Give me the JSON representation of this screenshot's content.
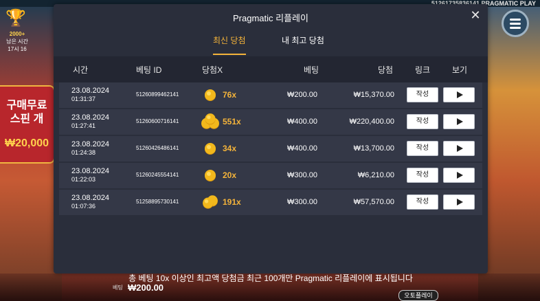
{
  "game": {
    "top_right": "51261735836141 PRAGMATIC PLAY",
    "jackpot_amount": "2000+",
    "time_left_label": "남은 시간",
    "time_left_value": "17시 16",
    "buy_line1": "구매무료",
    "buy_line2": "스핀 개",
    "buy_price": "₩20,000",
    "bet_label": "베팅",
    "bet_value": "₩200.00",
    "autoplay_label": "오토플레이"
  },
  "modal": {
    "title": "Pragmatic 리플레이",
    "close_icon": "close-icon",
    "tabs": [
      {
        "label": "최신 당첨",
        "active": true
      },
      {
        "label": "내 최고 당첨",
        "active": false
      }
    ],
    "columns": {
      "time": "시간",
      "bet_id": "베팅 ID",
      "multiplier": "당첨X",
      "bet": "베팅",
      "win": "당첨",
      "link": "링크",
      "view": "보기"
    },
    "rows": [
      {
        "date": "23.08.2024",
        "time": "01:31:37",
        "bet_id": "51260899462141",
        "coins": 1,
        "multiplier": "76x",
        "bet": "₩200.00",
        "win": "₩15,370.00",
        "link_label": "작성"
      },
      {
        "date": "23.08.2024",
        "time": "01:27:41",
        "bet_id": "51260600716141",
        "coins": 3,
        "multiplier": "551x",
        "bet": "₩400.00",
        "win": "₩220,400.00",
        "link_label": "작성"
      },
      {
        "date": "23.08.2024",
        "time": "01:24:38",
        "bet_id": "51260426486141",
        "coins": 1,
        "multiplier": "34x",
        "bet": "₩400.00",
        "win": "₩13,700.00",
        "link_label": "작성"
      },
      {
        "date": "23.08.2024",
        "time": "01:22:03",
        "bet_id": "51260245554141",
        "coins": 1,
        "multiplier": "20x",
        "bet": "₩300.00",
        "win": "₩6,210.00",
        "link_label": "작성"
      },
      {
        "date": "23.08.2024",
        "time": "01:07:36",
        "bet_id": "51258895730141",
        "coins": 2,
        "multiplier": "191x",
        "bet": "₩300.00",
        "win": "₩57,570.00",
        "link_label": "작성"
      }
    ],
    "footer_note": "총 베팅 10x 이상인 최고액 당첨금 최근 100개만 Pragmatic 리플레이에 표시됩니다"
  },
  "colors": {
    "accent": "#f5b43a",
    "modal_bg": "#2a2e3b",
    "row_bg": "#343847",
    "header_bg": "#232632",
    "coin": "#f2b81c"
  }
}
